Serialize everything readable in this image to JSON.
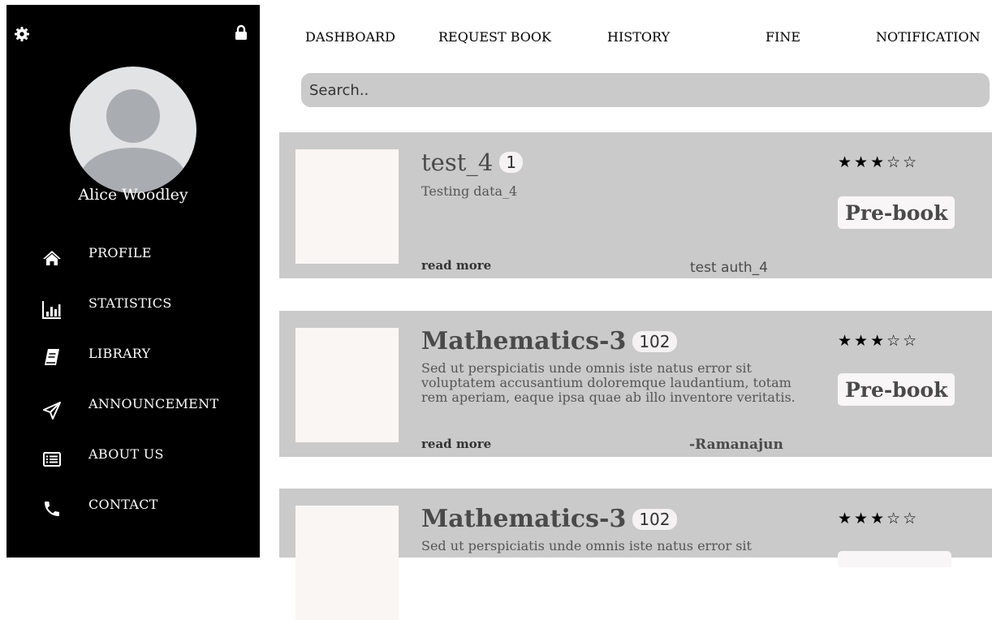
{
  "sidebar": {
    "user_name": "Alice Woodley",
    "top_icons": [
      "gear-icon",
      "lock-icon"
    ],
    "items": [
      {
        "label": "PROFILE",
        "icon": "home-icon"
      },
      {
        "label": "STATISTICS",
        "icon": "bar-chart-icon"
      },
      {
        "label": "LIBRARY",
        "icon": "book-icon"
      },
      {
        "label": "ANNOUNCEMENT",
        "icon": "paper-plane-icon"
      },
      {
        "label": "ABOUT US",
        "icon": "list-alt-icon"
      },
      {
        "label": "CONTACT",
        "icon": "phone-icon"
      }
    ]
  },
  "topnav": {
    "items": [
      "DASHBOARD",
      "REQUEST BOOK",
      "HISTORY",
      "FINE",
      "NOTIFICATION"
    ]
  },
  "search": {
    "placeholder": "Search.."
  },
  "books": [
    {
      "title": "test_4",
      "count": "1",
      "description": "Testing data_4",
      "read_more": "read more",
      "author": "test auth_4",
      "rating": 3,
      "rating_max": 5,
      "stars": "★★★☆☆",
      "button": "Pre-book"
    },
    {
      "title": "Mathematics-3",
      "count": "102",
      "description": "Sed ut perspiciatis unde omnis iste natus error sit voluptatem accusantium doloremque laudantium, totam rem aperiam, eaque ipsa quae ab illo inventore veritatis.",
      "read_more": "read more",
      "author": "-Ramanajun",
      "rating": 3,
      "rating_max": 5,
      "stars": "★★★☆☆",
      "button": "Pre-book"
    },
    {
      "title": "Mathematics-3",
      "count": "102",
      "description": "Sed ut perspiciatis unde omnis iste natus error sit",
      "rating": 3,
      "rating_max": 5,
      "stars": "★★★☆☆"
    }
  ],
  "colors": {
    "sidebar_bg": "#000000",
    "card_bg": "#cacaca",
    "search_bg": "#cacaca",
    "thumb_bg": "#faf6f4",
    "button_bg": "#f8f6f6",
    "title_text": "#4a4a4a"
  }
}
